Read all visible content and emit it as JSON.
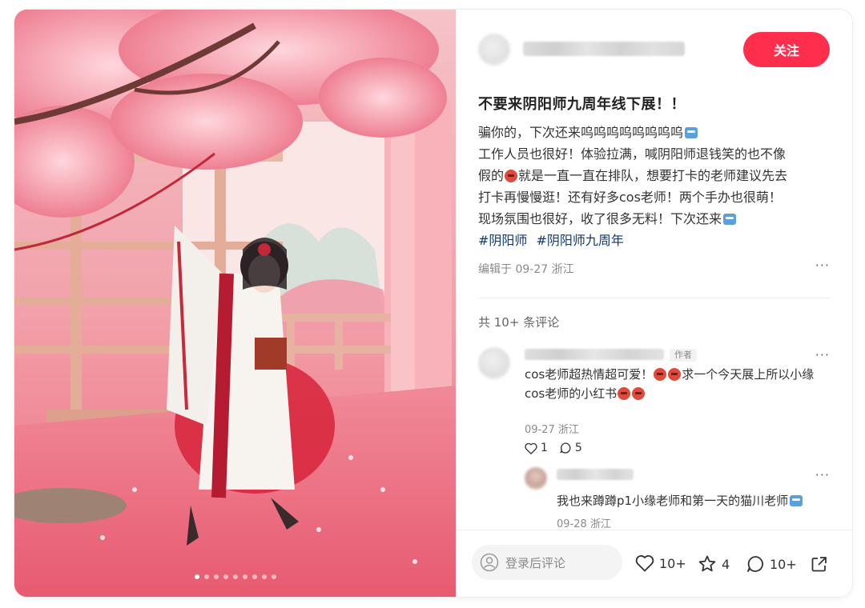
{
  "author": {
    "follow_label": "关注"
  },
  "post": {
    "title": "不要来阴阳师九周年线下展！！",
    "body_lines": [
      "骗你的，下次还来呜呜呜呜呜呜呜呜",
      "工作人员也很好！体验拉满，喊阴阳师退钱笑的也不像",
      "就是一直一直在排队，想要打卡的老师建议先去",
      "打卡再慢慢逛！还有好多cos老师！两个手办也很萌！",
      "现场氛围也很好，收了很多无料！下次还来"
    ],
    "body_line3_prefix": "假的",
    "tags": [
      "#阴阳师",
      "#阴阳师九周年"
    ],
    "meta": "编辑于 09-27 浙江",
    "more": "···"
  },
  "comments_header": "共 10+ 条评论",
  "comments": [
    {
      "badge": "作者",
      "text_a": "cos老师超热情超可爱！",
      "text_b": "求一个今天展上所以小缘",
      "text_c": "cos老师的小红书",
      "meta": "09-27 浙江",
      "likes": "1",
      "replies": "5",
      "more": "···"
    }
  ],
  "reply": {
    "text": "我也来蹲蹲p1小缘老师和第一天的猫川老师",
    "meta": "09-28 浙江",
    "more": "···"
  },
  "bottom_bar": {
    "input_placeholder": "登录后评论",
    "likes": "10+",
    "collects": "4",
    "comments": "10+"
  },
  "carousel": {
    "count": 9,
    "active_index": 0
  },
  "colors": {
    "accent": "#ff2e4d",
    "tag": "#13386c"
  },
  "icons": [
    "user-icon",
    "heart-icon",
    "star-icon",
    "comment-icon",
    "share-icon",
    "more-icon"
  ]
}
